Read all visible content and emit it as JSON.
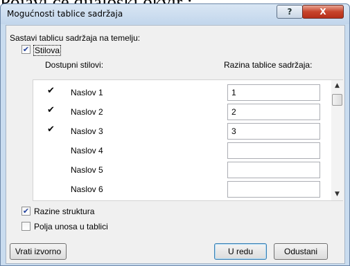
{
  "background_caption": "Pojavi će dijaloški okvir :",
  "dialog": {
    "title": "Mogućnosti tablice sadržaja",
    "help_glyph": "?",
    "close_glyph": "X"
  },
  "build_from_label": "Sastavi tablicu sadržaja na temelju:",
  "styles_checkbox": {
    "label": "Stilova",
    "checked": true
  },
  "columns": {
    "available_styles": "Dostupni stilovi:",
    "toc_level": "Razina tablice sadržaja:"
  },
  "styles": [
    {
      "name": "Naslov 1",
      "checked": true,
      "level": "1"
    },
    {
      "name": "Naslov 2",
      "checked": true,
      "level": "2"
    },
    {
      "name": "Naslov 3",
      "checked": true,
      "level": "3"
    },
    {
      "name": "Naslov 4",
      "checked": false,
      "level": ""
    },
    {
      "name": "Naslov 5",
      "checked": false,
      "level": ""
    },
    {
      "name": "Naslov 6",
      "checked": false,
      "level": ""
    }
  ],
  "outline_levels_checkbox": {
    "label": "Razine struktura",
    "checked": true
  },
  "table_entry_fields_checkbox": {
    "label": "Polja unosa u tablici",
    "checked": false
  },
  "buttons": {
    "reset": "Vrati izvorno",
    "ok": "U redu",
    "cancel": "Odustani"
  },
  "glyphs": {
    "check": "✔",
    "scroll_up": "▲",
    "scroll_down": "▼"
  }
}
